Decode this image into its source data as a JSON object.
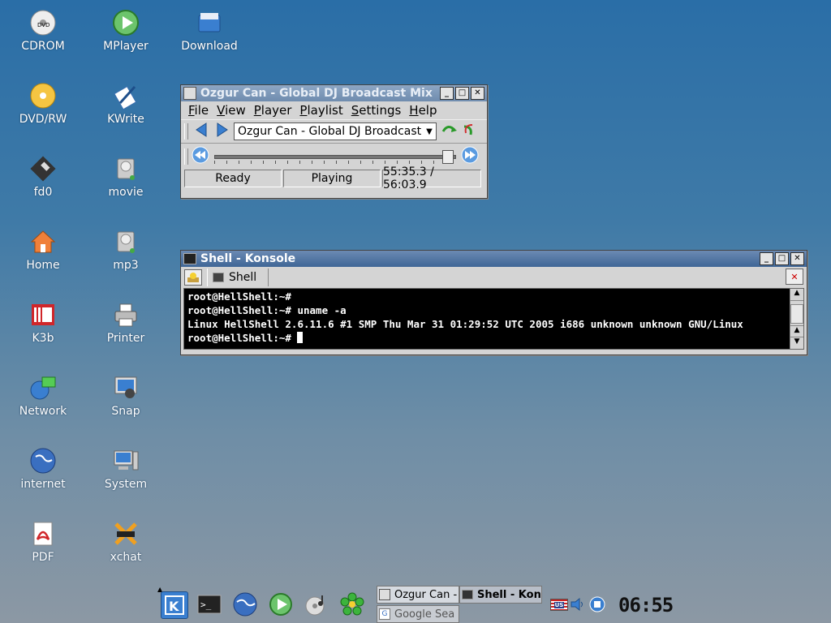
{
  "desktop": {
    "icons": [
      {
        "label": "CDROM",
        "icon": "cdrom-icon"
      },
      {
        "label": "MPlayer",
        "icon": "mplayer-icon"
      },
      {
        "label": "Download",
        "icon": "download-folder-icon"
      },
      {
        "label": "DVD/RW",
        "icon": "dvd-icon"
      },
      {
        "label": "KWrite",
        "icon": "kwrite-icon"
      },
      {
        "label": "fd0",
        "icon": "floppy-icon"
      },
      {
        "label": "movie",
        "icon": "harddisk-icon"
      },
      {
        "label": "Home",
        "icon": "home-icon"
      },
      {
        "label": "mp3",
        "icon": "harddisk-icon"
      },
      {
        "label": "K3b",
        "icon": "k3b-icon"
      },
      {
        "label": "Printer",
        "icon": "printer-icon"
      },
      {
        "label": "Network",
        "icon": "network-icon"
      },
      {
        "label": "Snap",
        "icon": "snap-icon"
      },
      {
        "label": "internet",
        "icon": "globe-icon"
      },
      {
        "label": "System",
        "icon": "system-icon"
      },
      {
        "label": "PDF",
        "icon": "pdf-icon"
      },
      {
        "label": "xchat",
        "icon": "xchat-icon"
      }
    ]
  },
  "player": {
    "title": "Ozgur Can - Global DJ Broadcast Mix",
    "menu": [
      "File",
      "View",
      "Player",
      "Playlist",
      "Settings",
      "Help"
    ],
    "track": "Ozgur Can - Global DJ Broadcast",
    "status": {
      "state": "Ready",
      "mode": "Playing",
      "time": "55:35.3 / 56:03.9"
    },
    "progress": 0.99
  },
  "konsole": {
    "title": "Shell - Konsole",
    "tab": "Shell",
    "lines": [
      "root@HellShell:~#",
      "root@HellShell:~# uname -a",
      "Linux HellShell 2.6.11.6 #1 SMP Thu Mar 31 01:29:52 UTC 2005 i686 unknown unknown GNU/Linux",
      "root@HellShell:~# "
    ]
  },
  "taskbar": {
    "tasks": [
      "Ozgur Can -",
      "Shell - Kon",
      "Google Sea"
    ],
    "clock": "06:55",
    "keyboard_layout": "US"
  },
  "colors": {
    "title_active": "#3f6696",
    "title_inactive": "#6f8cae",
    "terminal_bg": "#000000"
  }
}
